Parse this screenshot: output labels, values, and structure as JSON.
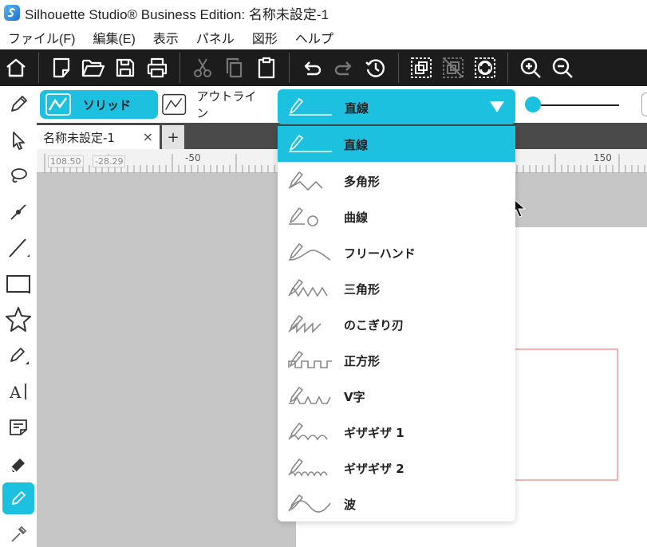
{
  "window": {
    "title": "Silhouette Studio® Business Edition: 名称未設定-1"
  },
  "menu": {
    "file": "ファイル(F)",
    "edit": "編集(E)",
    "view": "表示",
    "panel": "パネル",
    "shape": "図形",
    "help": "ヘルプ"
  },
  "toolbar_icons": [
    "home-icon",
    "new-document-icon",
    "open-folder-icon",
    "save-icon",
    "print-icon",
    "cut-icon",
    "copy-icon",
    "paste-icon",
    "undo-icon",
    "redo-icon",
    "history-icon",
    "group-icon",
    "ungroup-icon",
    "compound-icon",
    "zoom-in-icon",
    "zoom-out-icon"
  ],
  "options": {
    "solid_label": "ソリッド",
    "outline_label": "アウトライン"
  },
  "tabs": {
    "doc_label": "名称未設定-1",
    "close_glyph": "×",
    "add_glyph": "+"
  },
  "ruler": {
    "coord_x": "108.50",
    "coord_y": "-28.29",
    "label_left": "-50",
    "label_right": "150"
  },
  "stroke_style": {
    "selected": "直線",
    "items": [
      {
        "label": "直線",
        "icon": "straight-line-icon",
        "selected": true
      },
      {
        "label": "多角形",
        "icon": "polygon-line-icon"
      },
      {
        "label": "曲線",
        "icon": "curve-line-icon"
      },
      {
        "label": "フリーハンド",
        "icon": "freehand-line-icon"
      },
      {
        "label": "三角形",
        "icon": "triangle-line-icon"
      },
      {
        "label": "のこぎり刃",
        "icon": "sawtooth-line-icon"
      },
      {
        "label": "正方形",
        "icon": "square-wave-line-icon"
      },
      {
        "label": "V字",
        "icon": "v-shape-line-icon"
      },
      {
        "label": "ギザギザ 1",
        "icon": "zigzag-1-line-icon"
      },
      {
        "label": "ギザギザ 2",
        "icon": "zigzag-2-line-icon"
      },
      {
        "label": "波",
        "icon": "wave-line-icon"
      }
    ]
  },
  "colors": {
    "accent": "#1cc1e0",
    "toolbar_bg": "#1c1c1c",
    "canvas_gray": "#c6c6c6",
    "page_border": "#f3b3b3"
  }
}
